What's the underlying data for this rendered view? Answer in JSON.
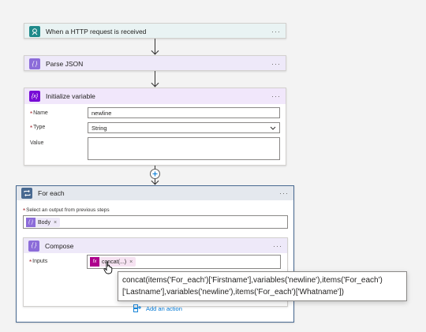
{
  "colors": {
    "http_trigger": "#1f8a8a",
    "http_header_bg": "#e9f3f3",
    "data_ops": "#8c6cd9",
    "data_header_bg": "#eee9f9",
    "variable": "#770bd6",
    "variable_header_bg": "#f1e7fb",
    "foreach": "#486991",
    "foreach_header_bg": "#e4e8ee",
    "expression": "#ad008c",
    "link": "#0078d4"
  },
  "steps": {
    "http": {
      "title": "When a HTTP request is received",
      "icon": "http-trigger-icon",
      "more": "···"
    },
    "parse": {
      "title": "Parse JSON",
      "icon": "data-operations-icon",
      "more": "···"
    },
    "initvar": {
      "title": "Initialize variable",
      "icon": "variable-icon",
      "more": "···",
      "name_label": "Name",
      "name_value": "newline",
      "type_label": "Type",
      "type_value": "String",
      "value_label": "Value",
      "required_mark": "*"
    },
    "foreach": {
      "title": "For each",
      "icon": "loop-icon",
      "more": "···",
      "select_label": "Select an output from previous steps",
      "token_label": "Body",
      "required_mark": "*"
    },
    "compose": {
      "title": "Compose",
      "icon": "data-operations-icon",
      "more": "···",
      "inputs_label": "Inputs",
      "token_label": "concat(...)",
      "required_mark": "*"
    }
  },
  "tooltip": {
    "line1": "concat(items('For_each')['Firstname'],variables('newline'),items('For_each')",
    "line2": "['Lastname'],variables('newline'),items('For_each')['Whatname'])"
  },
  "add_action": {
    "label": "Add an action"
  },
  "remove_glyph": "×"
}
